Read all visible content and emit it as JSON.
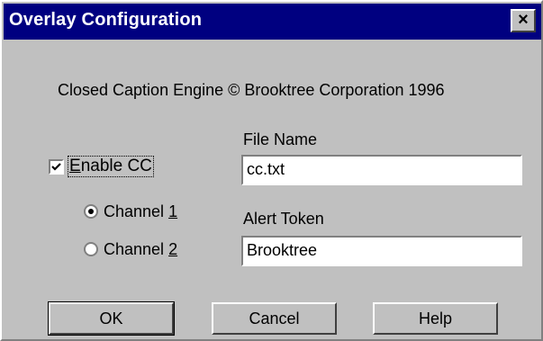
{
  "window": {
    "title": "Overlay Configuration",
    "close_label": "×"
  },
  "caption": "Closed Caption Engine ©  Brooktree Corporation 1996",
  "enable_cc": {
    "label_prefix": "",
    "mnemonic": "E",
    "label_rest": "nable CC",
    "checked": true
  },
  "channels": [
    {
      "label_prefix": "Channel ",
      "mnemonic": "1",
      "selected": true
    },
    {
      "label_prefix": "Channel ",
      "mnemonic": "2",
      "selected": false
    }
  ],
  "file_name": {
    "label": "File Name",
    "value": "cc.txt"
  },
  "alert_token": {
    "label": "Alert Token",
    "value": "Brooktree"
  },
  "buttons": {
    "ok": "OK",
    "cancel": "Cancel",
    "help": "Help"
  }
}
